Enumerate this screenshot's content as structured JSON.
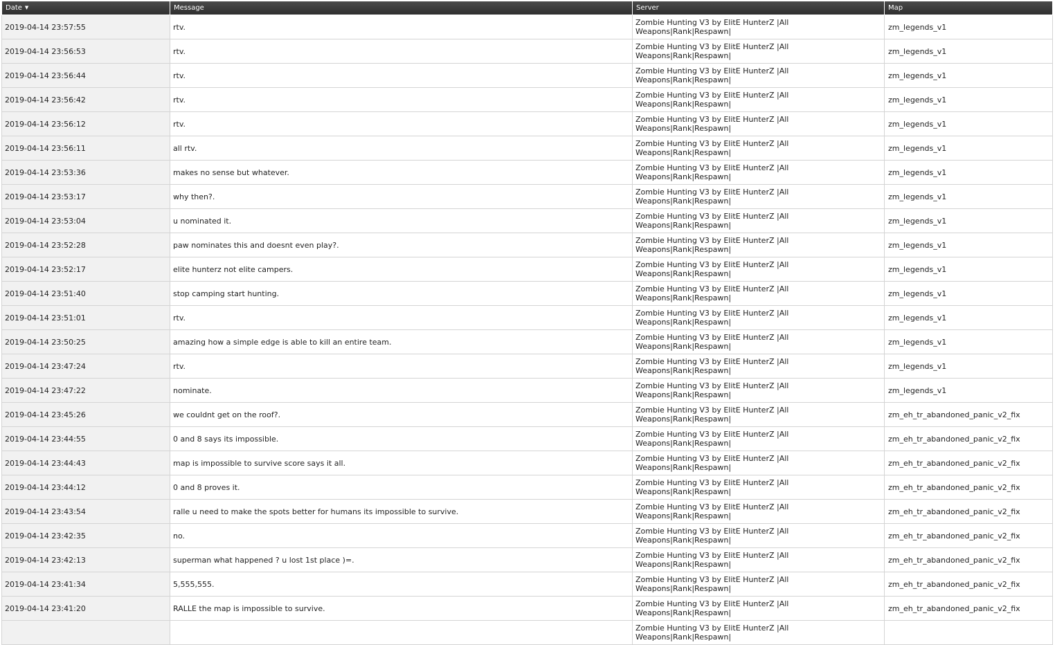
{
  "table": {
    "columns": {
      "date": "Date",
      "message": "Message",
      "server": "Server",
      "map": "Map"
    },
    "sort_indicator": "▼",
    "rows": [
      {
        "date": "2019-04-14 23:57:55",
        "message": "rtv.",
        "server": "Zombie Hunting V3 by ElitE HunterZ |All Weapons|Rank|Respawn|",
        "map": "zm_legends_v1"
      },
      {
        "date": "2019-04-14 23:56:53",
        "message": "rtv.",
        "server": "Zombie Hunting V3 by ElitE HunterZ |All Weapons|Rank|Respawn|",
        "map": "zm_legends_v1"
      },
      {
        "date": "2019-04-14 23:56:44",
        "message": "rtv.",
        "server": "Zombie Hunting V3 by ElitE HunterZ |All Weapons|Rank|Respawn|",
        "map": "zm_legends_v1"
      },
      {
        "date": "2019-04-14 23:56:42",
        "message": "rtv.",
        "server": "Zombie Hunting V3 by ElitE HunterZ |All Weapons|Rank|Respawn|",
        "map": "zm_legends_v1"
      },
      {
        "date": "2019-04-14 23:56:12",
        "message": "rtv.",
        "server": "Zombie Hunting V3 by ElitE HunterZ |All Weapons|Rank|Respawn|",
        "map": "zm_legends_v1"
      },
      {
        "date": "2019-04-14 23:56:11",
        "message": "all rtv.",
        "server": "Zombie Hunting V3 by ElitE HunterZ |All Weapons|Rank|Respawn|",
        "map": "zm_legends_v1"
      },
      {
        "date": "2019-04-14 23:53:36",
        "message": "makes no sense but whatever.",
        "server": "Zombie Hunting V3 by ElitE HunterZ |All Weapons|Rank|Respawn|",
        "map": "zm_legends_v1"
      },
      {
        "date": "2019-04-14 23:53:17",
        "message": "why then?.",
        "server": "Zombie Hunting V3 by ElitE HunterZ |All Weapons|Rank|Respawn|",
        "map": "zm_legends_v1"
      },
      {
        "date": "2019-04-14 23:53:04",
        "message": "u nominated it.",
        "server": "Zombie Hunting V3 by ElitE HunterZ |All Weapons|Rank|Respawn|",
        "map": "zm_legends_v1"
      },
      {
        "date": "2019-04-14 23:52:28",
        "message": "paw nominates this and doesnt even play?.",
        "server": "Zombie Hunting V3 by ElitE HunterZ |All Weapons|Rank|Respawn|",
        "map": "zm_legends_v1"
      },
      {
        "date": "2019-04-14 23:52:17",
        "message": "elite hunterz not elite campers.",
        "server": "Zombie Hunting V3 by ElitE HunterZ |All Weapons|Rank|Respawn|",
        "map": "zm_legends_v1"
      },
      {
        "date": "2019-04-14 23:51:40",
        "message": "stop camping start hunting.",
        "server": "Zombie Hunting V3 by ElitE HunterZ |All Weapons|Rank|Respawn|",
        "map": "zm_legends_v1"
      },
      {
        "date": "2019-04-14 23:51:01",
        "message": "rtv.",
        "server": "Zombie Hunting V3 by ElitE HunterZ |All Weapons|Rank|Respawn|",
        "map": "zm_legends_v1"
      },
      {
        "date": "2019-04-14 23:50:25",
        "message": "amazing how a simple edge is able to kill an entire team.",
        "server": "Zombie Hunting V3 by ElitE HunterZ |All Weapons|Rank|Respawn|",
        "map": "zm_legends_v1"
      },
      {
        "date": "2019-04-14 23:47:24",
        "message": "rtv.",
        "server": "Zombie Hunting V3 by ElitE HunterZ |All Weapons|Rank|Respawn|",
        "map": "zm_legends_v1"
      },
      {
        "date": "2019-04-14 23:47:22",
        "message": "nominate.",
        "server": "Zombie Hunting V3 by ElitE HunterZ |All Weapons|Rank|Respawn|",
        "map": "zm_legends_v1"
      },
      {
        "date": "2019-04-14 23:45:26",
        "message": "we couldnt get on the roof?.",
        "server": "Zombie Hunting V3 by ElitE HunterZ |All Weapons|Rank|Respawn|",
        "map": "zm_eh_tr_abandoned_panic_v2_fix"
      },
      {
        "date": "2019-04-14 23:44:55",
        "message": "0 and 8 says its impossible.",
        "server": "Zombie Hunting V3 by ElitE HunterZ |All Weapons|Rank|Respawn|",
        "map": "zm_eh_tr_abandoned_panic_v2_fix"
      },
      {
        "date": "2019-04-14 23:44:43",
        "message": "map is impossible to survive score says it all.",
        "server": "Zombie Hunting V3 by ElitE HunterZ |All Weapons|Rank|Respawn|",
        "map": "zm_eh_tr_abandoned_panic_v2_fix"
      },
      {
        "date": "2019-04-14 23:44:12",
        "message": "0 and 8 proves it.",
        "server": "Zombie Hunting V3 by ElitE HunterZ |All Weapons|Rank|Respawn|",
        "map": "zm_eh_tr_abandoned_panic_v2_fix"
      },
      {
        "date": "2019-04-14 23:43:54",
        "message": "ralle u need to make the spots better for humans its impossible to survive.",
        "server": "Zombie Hunting V3 by ElitE HunterZ |All Weapons|Rank|Respawn|",
        "map": "zm_eh_tr_abandoned_panic_v2_fix"
      },
      {
        "date": "2019-04-14 23:42:35",
        "message": "no.",
        "server": "Zombie Hunting V3 by ElitE HunterZ |All Weapons|Rank|Respawn|",
        "map": "zm_eh_tr_abandoned_panic_v2_fix"
      },
      {
        "date": "2019-04-14 23:42:13",
        "message": "superman what happened ? u lost 1st place )=.",
        "server": "Zombie Hunting V3 by ElitE HunterZ |All Weapons|Rank|Respawn|",
        "map": "zm_eh_tr_abandoned_panic_v2_fix"
      },
      {
        "date": "2019-04-14 23:41:34",
        "message": "5,555,555.",
        "server": "Zombie Hunting V3 by ElitE HunterZ |All Weapons|Rank|Respawn|",
        "map": "zm_eh_tr_abandoned_panic_v2_fix"
      },
      {
        "date": "2019-04-14 23:41:20",
        "message": "RALLE the map is impossible to survive.",
        "server": "Zombie Hunting V3 by ElitE HunterZ |All Weapons|Rank|Respawn|",
        "map": "zm_eh_tr_abandoned_panic_v2_fix"
      },
      {
        "date": "",
        "message": "",
        "server": "Zombie Hunting V3 by ElitE HunterZ |All Weapons|Rank|Respawn|",
        "map": ""
      }
    ]
  }
}
